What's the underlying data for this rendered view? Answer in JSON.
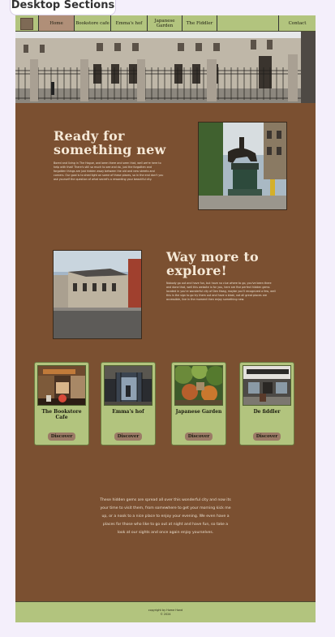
{
  "canvas": {
    "label": "Desktop Sections"
  },
  "nav": {
    "items": [
      {
        "label": "Home",
        "active": true
      },
      {
        "label": "Bookstore cafe"
      },
      {
        "label": "Emma's hof"
      },
      {
        "label": "Japanese Garden"
      },
      {
        "label": "The Fiddler"
      }
    ],
    "contact": "Contact"
  },
  "hero": {
    "image": "palace-courtyard-photo"
  },
  "section1": {
    "heading": "Ready for something new",
    "body": "Bored and living in The Hague, and been there and seen that, well we're here to help with that! There's still so much to see and do, just the forgotten and forgotten things are just hidden away between the old and new streets and corners. Our goal is to shed light on some of these places, so in the end don't you ask yourself the question of what secret's a rewarding your beautiful city.",
    "image": "equestrian-statue-photo"
  },
  "section2": {
    "heading": "Way more to explore!",
    "body": "Nobody go out and have fun, but have no clue where to go, you've been there and done that, well this website is for you, here are five perfect hidden gems located in you're wonderful city of Den Haag, maybe you'll recognized a few, well this is the sign to go try them out and have a blast, not all great places are accessible, live in the moment then enjoy something new.",
    "image": "palace-building-photo"
  },
  "cards": [
    {
      "title": "The Bookstore Cafe",
      "button": "Discover",
      "image": "bookstore-cafe-photo"
    },
    {
      "title": "Emma's hof",
      "button": "Discover",
      "image": "emmas-hof-photo"
    },
    {
      "title": "Japanese Garden",
      "button": "Discover",
      "image": "japanese-garden-photo"
    },
    {
      "title": "De fiddler",
      "button": "Discover",
      "image": "de-fiddler-photo"
    }
  ],
  "closing": "These hidden gems are spread all over this wonderful city and now its your time to visit them, from somewhere to get your morning kick me up, or a nook to a nice place to enjoy your evening. We even have a places for those who like to go out at night and have fun, so take a look at our sights and once again enjoy yourselves.",
  "footer": {
    "line1": "copyright by Home Hand",
    "line2": "© 2024"
  },
  "colors": {
    "background": "#7b5031",
    "nav": "#b2c47e",
    "active": "#b08f78",
    "button": "#9b7a66",
    "text_light": "#f5e8d6"
  }
}
